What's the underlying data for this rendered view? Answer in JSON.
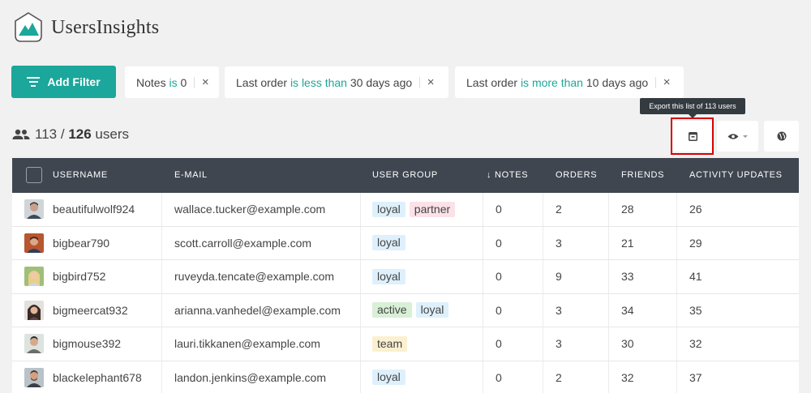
{
  "brand": {
    "name": "UsersInsights",
    "color": "#1ba79b"
  },
  "toolbar": {
    "add_filter_label": "Add Filter",
    "filters": [
      {
        "field": "Notes",
        "operator": "is",
        "value": "0"
      },
      {
        "field": "Last order",
        "operator": "is less than",
        "value": "30 days ago"
      },
      {
        "field": "Last order",
        "operator": "is more than",
        "value": "10 days ago"
      }
    ],
    "remove_icon": "×"
  },
  "summary": {
    "shown": "113",
    "separator": "/",
    "total": "126",
    "unit": "users"
  },
  "export_tooltip": "Export this list of 113 users",
  "actions": {
    "export_icon": "export-icon",
    "visibility_icon": "eye-icon",
    "map_icon": "globe-icon",
    "highlight_color": "#d80000"
  },
  "table": {
    "columns": [
      "USERNAME",
      "E-MAIL",
      "USER GROUP",
      "↓ NOTES",
      "ORDERS",
      "FRIENDS",
      "ACTIVITY UPDATES"
    ],
    "rows": [
      {
        "username": "beautifulwolf924",
        "email": "wallace.tucker@example.com",
        "groups": [
          "loyal",
          "partner"
        ],
        "notes": "0",
        "orders": "2",
        "friends": "28",
        "activity": "26"
      },
      {
        "username": "bigbear790",
        "email": "scott.carroll@example.com",
        "groups": [
          "loyal"
        ],
        "notes": "0",
        "orders": "3",
        "friends": "21",
        "activity": "29"
      },
      {
        "username": "bigbird752",
        "email": "ruveyda.tencate@example.com",
        "groups": [
          "loyal"
        ],
        "notes": "0",
        "orders": "9",
        "friends": "33",
        "activity": "41"
      },
      {
        "username": "bigmeercat932",
        "email": "arianna.vanhedel@example.com",
        "groups": [
          "active",
          "loyal"
        ],
        "notes": "0",
        "orders": "3",
        "friends": "34",
        "activity": "35"
      },
      {
        "username": "bigmouse392",
        "email": "lauri.tikkanen@example.com",
        "groups": [
          "team"
        ],
        "notes": "0",
        "orders": "3",
        "friends": "30",
        "activity": "32"
      },
      {
        "username": "blackelephant678",
        "email": "landon.jenkins@example.com",
        "groups": [
          "loyal"
        ],
        "notes": "0",
        "orders": "2",
        "friends": "32",
        "activity": "37"
      }
    ]
  }
}
